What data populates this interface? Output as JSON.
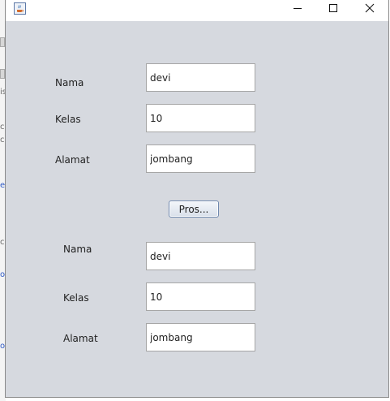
{
  "window": {
    "title": "",
    "controls": {
      "minimize_icon": "minimize-icon",
      "maximize_icon": "maximize-icon",
      "close_icon": "close-icon"
    }
  },
  "input_form": {
    "nama": {
      "label": "Nama",
      "value": "devi"
    },
    "kelas": {
      "label": "Kelas",
      "value": "10"
    },
    "alamat": {
      "label": "Alamat",
      "value": "jombang"
    }
  },
  "process_button": {
    "label": "Pros..."
  },
  "output_form": {
    "nama": {
      "label": "Nama",
      "value": "devi"
    },
    "kelas": {
      "label": "Kelas",
      "value": "10"
    },
    "alamat": {
      "label": "Alamat",
      "value": "jombang"
    }
  },
  "background_window": {
    "fragments": [
      "is",
      "c",
      "c",
      "e",
      "c",
      "o",
      "o"
    ]
  },
  "colors": {
    "window_background": "#d6d9df",
    "titlebar": "#ffffff",
    "field_background": "#ffffff"
  }
}
